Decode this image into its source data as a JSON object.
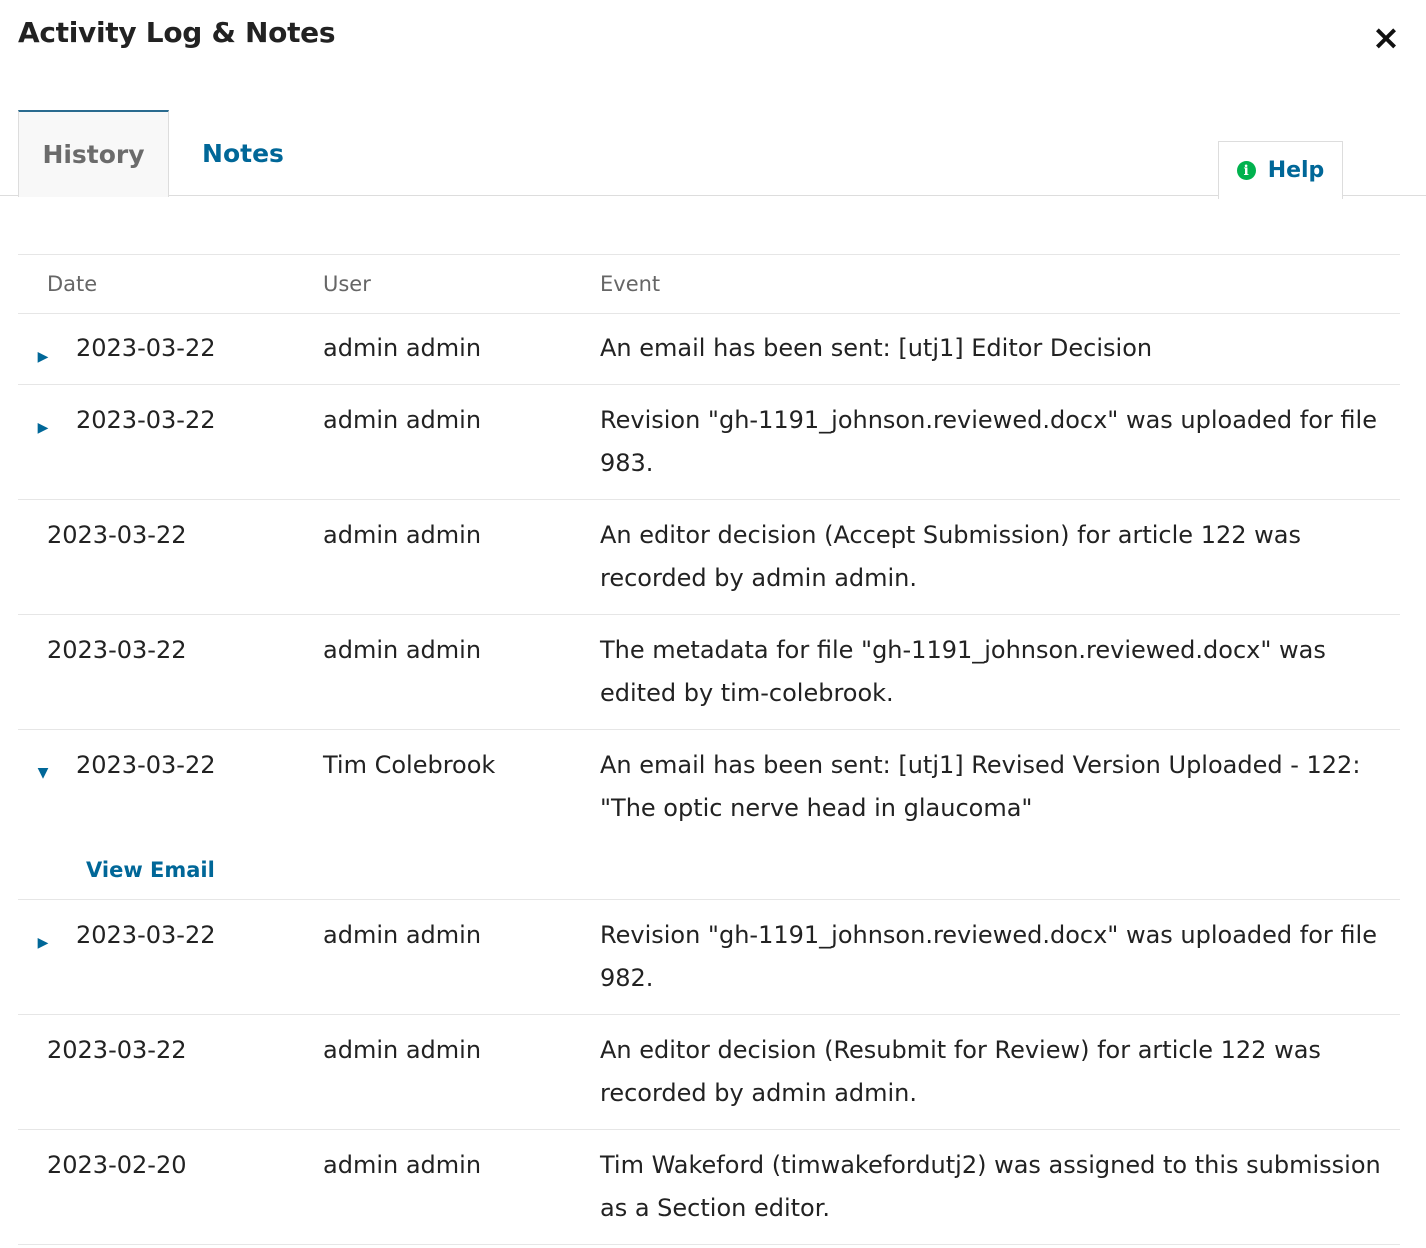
{
  "modal": {
    "title": "Activity Log & Notes",
    "close_icon": "×"
  },
  "tabs": [
    {
      "label": "History",
      "active": true
    },
    {
      "label": "Notes",
      "active": false
    }
  ],
  "help": {
    "label": "Help",
    "icon": "info-icon"
  },
  "table": {
    "columns": [
      "Date",
      "User",
      "Event"
    ],
    "rows": [
      {
        "date": "2023-03-22",
        "user": "admin admin",
        "event": "An email has been sent: [utj1] Editor Decision",
        "toggle": "collapsed"
      },
      {
        "date": "2023-03-22",
        "user": "admin admin",
        "event": "Revision \"gh-1191_johnson.reviewed.docx\" was uploaded for file 983.",
        "toggle": "collapsed"
      },
      {
        "date": "2023-03-22",
        "user": "admin admin",
        "event": "An editor decision (Accept Submission) for article 122 was recorded by admin admin.",
        "toggle": "none"
      },
      {
        "date": "2023-03-22",
        "user": "admin admin",
        "event": "The metadata for file \"gh-1191_johnson.reviewed.docx\" was edited by tim-colebrook.",
        "toggle": "none"
      },
      {
        "date": "2023-03-22",
        "user": "Tim Colebrook",
        "event": "An email has been sent: [utj1] Revised Version Uploaded - 122: \"The optic nerve head in glaucoma\"",
        "toggle": "expanded",
        "detail_link": "View Email"
      },
      {
        "date": "2023-03-22",
        "user": "admin admin",
        "event": "Revision \"gh-1191_johnson.reviewed.docx\" was uploaded for file 982.",
        "toggle": "collapsed"
      },
      {
        "date": "2023-03-22",
        "user": "admin admin",
        "event": "An editor decision (Resubmit for Review) for article 122 was recorded by admin admin.",
        "toggle": "none"
      },
      {
        "date": "2023-02-20",
        "user": "admin admin",
        "event": "Tim Wakeford (timwakefordutj2) was assigned to this submission as a Section editor.",
        "toggle": "none"
      }
    ]
  },
  "colors": {
    "link": "#006798",
    "tab_active_border": "#2a6b8f",
    "help_icon": "#00b24e",
    "text": "#222222",
    "muted": "#666666"
  }
}
